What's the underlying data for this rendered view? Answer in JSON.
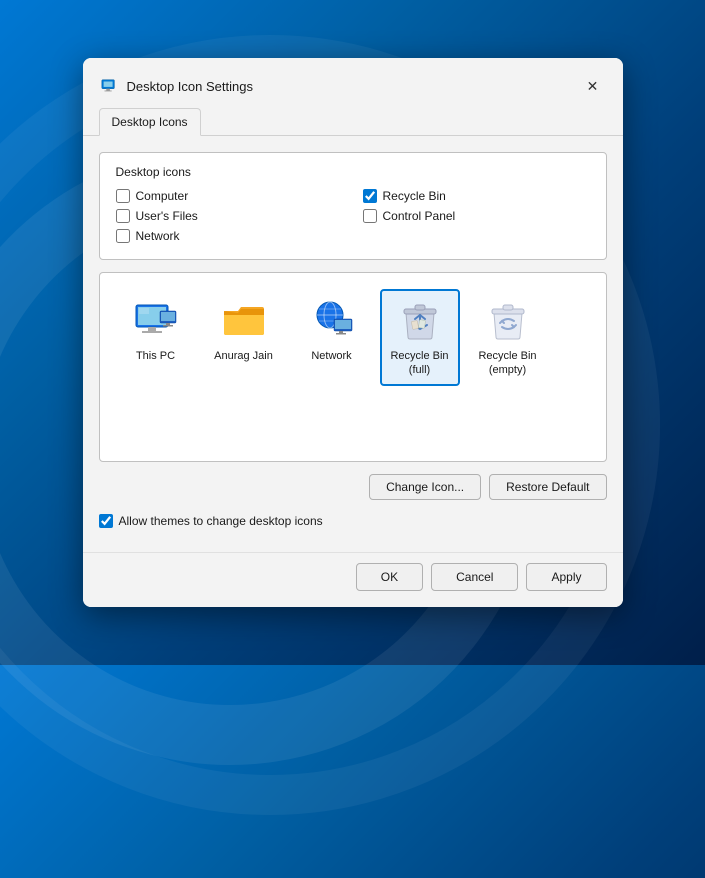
{
  "dialog": {
    "title": "Desktop Icon Settings",
    "close_label": "✕"
  },
  "tabs": [
    {
      "id": "desktop-icons",
      "label": "Desktop Icons",
      "active": true
    }
  ],
  "section": {
    "label": "Desktop icons"
  },
  "checkboxes": [
    {
      "id": "computer",
      "label": "Computer",
      "checked": false
    },
    {
      "id": "recycle-bin",
      "label": "Recycle Bin",
      "checked": true
    },
    {
      "id": "users-files",
      "label": "User's Files",
      "checked": false
    },
    {
      "id": "control-panel",
      "label": "Control Panel",
      "checked": false
    },
    {
      "id": "network",
      "label": "Network",
      "checked": false
    }
  ],
  "icons": [
    {
      "id": "this-pc",
      "label": "This PC",
      "selected": false
    },
    {
      "id": "anurag-jain",
      "label": "Anurag Jain",
      "selected": false
    },
    {
      "id": "network",
      "label": "Network",
      "selected": false
    },
    {
      "id": "recycle-bin-full",
      "label": "Recycle Bin\n(full)",
      "selected": true
    },
    {
      "id": "recycle-bin-empty",
      "label": "Recycle Bin\n(empty)",
      "selected": false
    }
  ],
  "buttons": {
    "change_icon": "Change Icon...",
    "restore_default": "Restore Default"
  },
  "allow_themes": {
    "label": "Allow themes to change desktop icons",
    "checked": true
  },
  "footer": {
    "ok": "OK",
    "cancel": "Cancel",
    "apply": "Apply"
  }
}
